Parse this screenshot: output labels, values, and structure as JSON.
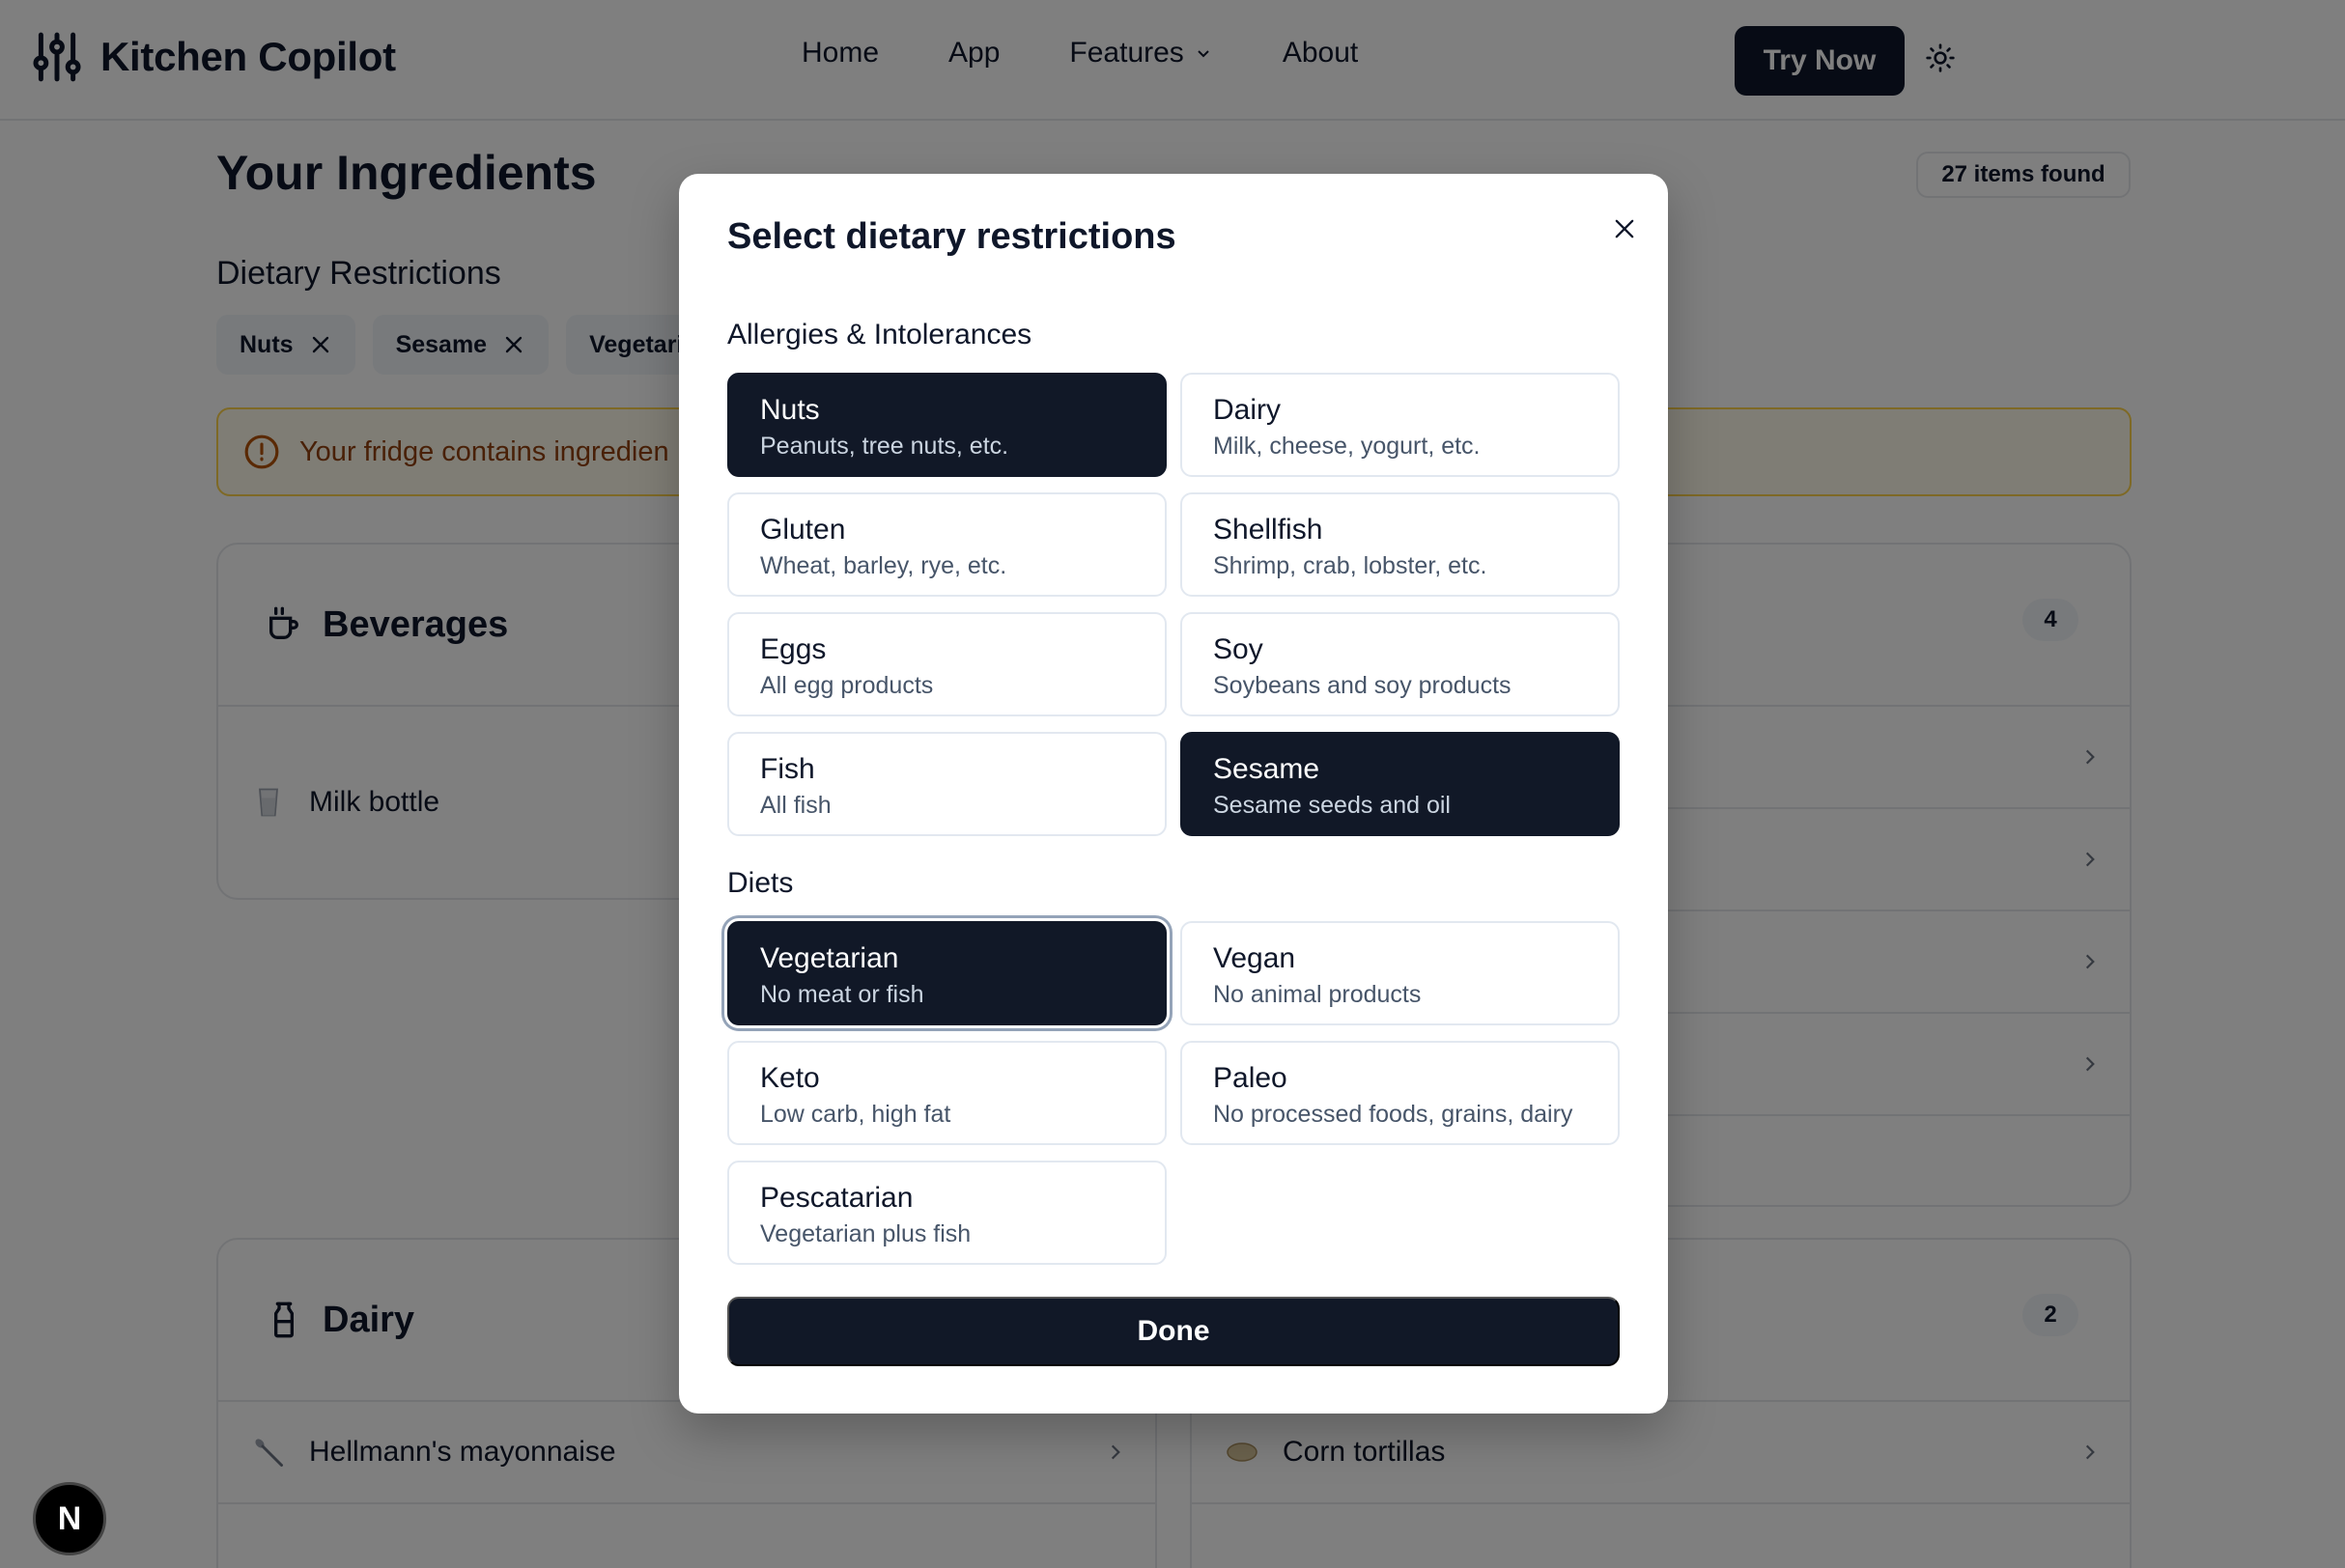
{
  "header": {
    "app_name": "Kitchen Copilot",
    "nav": [
      {
        "label": "Home"
      },
      {
        "label": "App"
      },
      {
        "label": "Features"
      },
      {
        "label": "About"
      }
    ],
    "cta_label": "Try Now",
    "theme_icon": "sun-icon"
  },
  "page": {
    "title": "Your Ingredients",
    "items_found": "27 items found",
    "restrictions_label": "Dietary Restrictions",
    "chips": [
      {
        "label": "Nuts"
      },
      {
        "label": "Sesame"
      },
      {
        "label": "Vegetaria"
      }
    ],
    "alert_text": "Your fridge contains ingredien",
    "beverages": {
      "title": "Beverages",
      "count": "4",
      "rows": [
        {
          "label": "Milk bottle"
        }
      ]
    },
    "dairy": {
      "title": "Dairy",
      "count": "2",
      "rows": [
        {
          "label": "Hellmann's mayonnaise"
        },
        {
          "label": "Corn tortillas"
        }
      ]
    }
  },
  "modal": {
    "title": "Select dietary restrictions",
    "allergies_label": "Allergies & Intolerances",
    "allergies": [
      {
        "title": "Nuts",
        "subtitle": "Peanuts, tree nuts, etc.",
        "selected": true
      },
      {
        "title": "Dairy",
        "subtitle": "Milk, cheese, yogurt, etc.",
        "selected": false
      },
      {
        "title": "Gluten",
        "subtitle": "Wheat, barley, rye, etc.",
        "selected": false
      },
      {
        "title": "Shellfish",
        "subtitle": "Shrimp, crab, lobster, etc.",
        "selected": false
      },
      {
        "title": "Eggs",
        "subtitle": "All egg products",
        "selected": false
      },
      {
        "title": "Soy",
        "subtitle": "Soybeans and soy products",
        "selected": false
      },
      {
        "title": "Fish",
        "subtitle": "All fish",
        "selected": false
      },
      {
        "title": "Sesame",
        "subtitle": "Sesame seeds and oil",
        "selected": true
      }
    ],
    "diets_label": "Diets",
    "diets": [
      {
        "title": "Vegetarian",
        "subtitle": "No meat or fish",
        "selected": true
      },
      {
        "title": "Vegan",
        "subtitle": "No animal products",
        "selected": false
      },
      {
        "title": "Keto",
        "subtitle": "Low carb, high fat",
        "selected": false
      },
      {
        "title": "Paleo",
        "subtitle": "No processed foods, grains, dairy",
        "selected": false
      },
      {
        "title": "Pescatarian",
        "subtitle": "Vegetarian plus fish",
        "selected": false
      }
    ],
    "done_label": "Done"
  },
  "dev_badge": "N"
}
